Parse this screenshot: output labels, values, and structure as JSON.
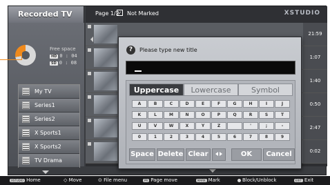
{
  "header": {
    "title": "Recorded TV",
    "page_info": "Page  1/2",
    "not_marked": "Not Marked",
    "brand": "XSTUDIO"
  },
  "storage": {
    "free_space_label": "Free space",
    "hd_tag": "HD",
    "hd_value": "0 : 04",
    "sd_tag": "SD",
    "sd_value": "0 : 08"
  },
  "categories": [
    {
      "label": "My TV"
    },
    {
      "label": "Series1"
    },
    {
      "label": "Series2"
    },
    {
      "label": "X Sports1"
    },
    {
      "label": "X Sports2"
    },
    {
      "label": "TV Drama"
    }
  ],
  "recordings": [
    {
      "time": "21:59"
    },
    {
      "time": "1:07"
    },
    {
      "time": "1:40"
    },
    {
      "time": "0:50"
    },
    {
      "time": "2:47"
    },
    {
      "time": "0:02"
    }
  ],
  "dialog": {
    "prompt": "Please type new title",
    "input_value": "",
    "tabs": {
      "uppercase": "Uppercase",
      "lowercase": "Lowercase",
      "symbol": "Symbol"
    },
    "keys": [
      [
        "A",
        "B",
        "C",
        "D",
        "E",
        "F",
        "G",
        "H",
        "I",
        "J"
      ],
      [
        "K",
        "L",
        "M",
        "N",
        "O",
        "P",
        "Q",
        "R",
        "S",
        "T"
      ],
      [
        "U",
        "V",
        "W",
        "X",
        "Y",
        "Z",
        "",
        "'",
        ";",
        "-"
      ],
      [
        "0",
        "1",
        "2",
        "3",
        "4",
        "5",
        "6",
        "7",
        "8",
        "9"
      ]
    ],
    "buttons": {
      "space": "Space",
      "delete": "Delete",
      "clear": "Clear",
      "ok": "OK",
      "cancel": "Cancel"
    }
  },
  "footer": {
    "home_badge": "XSTUDIO",
    "home": "Home",
    "move": "Move",
    "file_menu": "File menu",
    "page_badge": "PR",
    "page_move": "Page move",
    "mark_badge": "MARK",
    "mark": "Mark",
    "block": "Block/Unblock",
    "exit_badge": "EXIT",
    "exit": "Exit"
  },
  "colors": {
    "accent": "#f08a1c",
    "panel": "#3a3c40",
    "dialog": "#c9ccd1"
  }
}
